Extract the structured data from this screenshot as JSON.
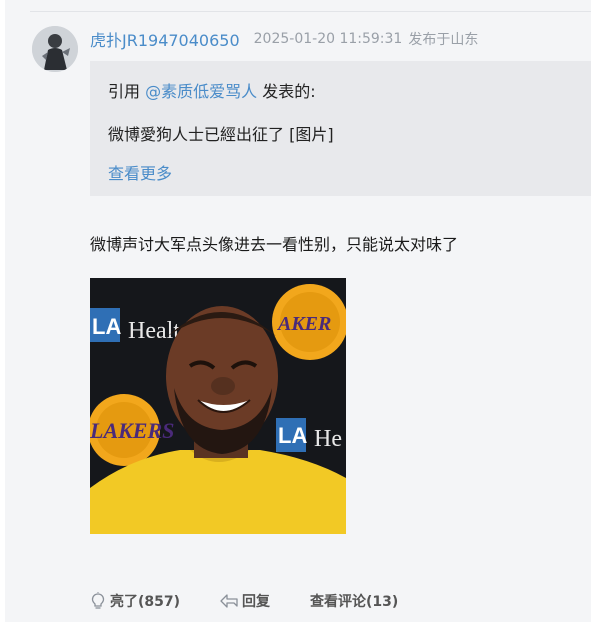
{
  "post": {
    "username": "虎扑JR1947040650",
    "timestamp": "2025-01-20 11:59:31",
    "location": "发布于山东",
    "quote": {
      "prefix": "引用 ",
      "user": "@素质低爱骂人",
      "suffix": " 发表的:",
      "text": "微博愛狗人士已經出征了 [图片]",
      "more": "查看更多"
    },
    "content": "微博声讨大军点头像进去一看性别，只能说太对味了",
    "image": {
      "banner_left": "LA Health",
      "banner_right": "LA He",
      "badge_text": "LAKERS"
    }
  },
  "actions": {
    "like": "亮了(857)",
    "reply": "回复",
    "view_comments": "查看评论(13)"
  },
  "colors": {
    "link": "#4a8cc9",
    "meta": "#9aa0a8",
    "panel_bg": "#f4f5f7",
    "quote_bg": "#e8e9ec"
  },
  "icons": {
    "like": "lightbulb-icon",
    "reply": "reply-arrow-icon"
  }
}
